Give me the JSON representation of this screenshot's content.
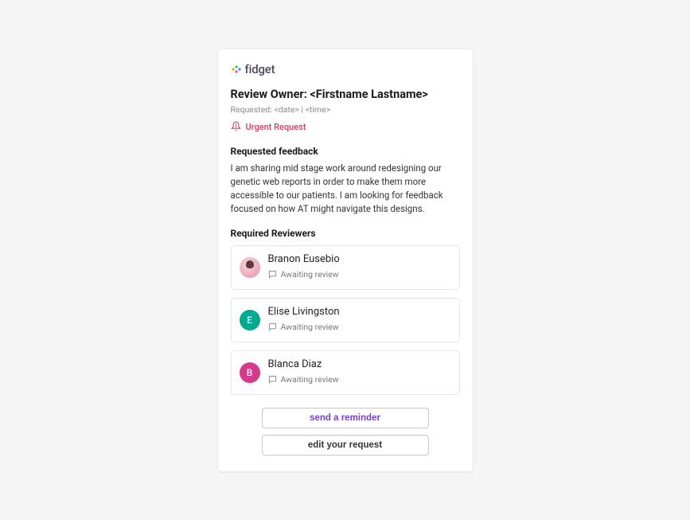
{
  "logo": {
    "text": "fidget"
  },
  "title": "Review Owner: <Firstname Lastname>",
  "meta": "Requested: <date> | <time>",
  "urgent_label": "Urgent Request",
  "feedback_heading": "Requested feedback",
  "feedback_body": "I am sharing mid stage work around redesigning our genetic web reports in order to make them more accessible to our patients. I am looking for feedback focused on how AT might navigate this designs.",
  "reviewers_heading": "Required Reviewers",
  "reviewers": [
    {
      "name": "Branon Eusebio",
      "status": "Awaiting review",
      "initial": ""
    },
    {
      "name": "Elise Livingston",
      "status": "Awaiting review",
      "initial": "E"
    },
    {
      "name": "Blanca Diaz",
      "status": "Awaiting review",
      "initial": "B"
    }
  ],
  "actions": {
    "reminder": "send a reminder",
    "edit": "edit your request"
  },
  "colors": {
    "urgent": "#d63a5e",
    "primary": "#7a3ec9"
  }
}
